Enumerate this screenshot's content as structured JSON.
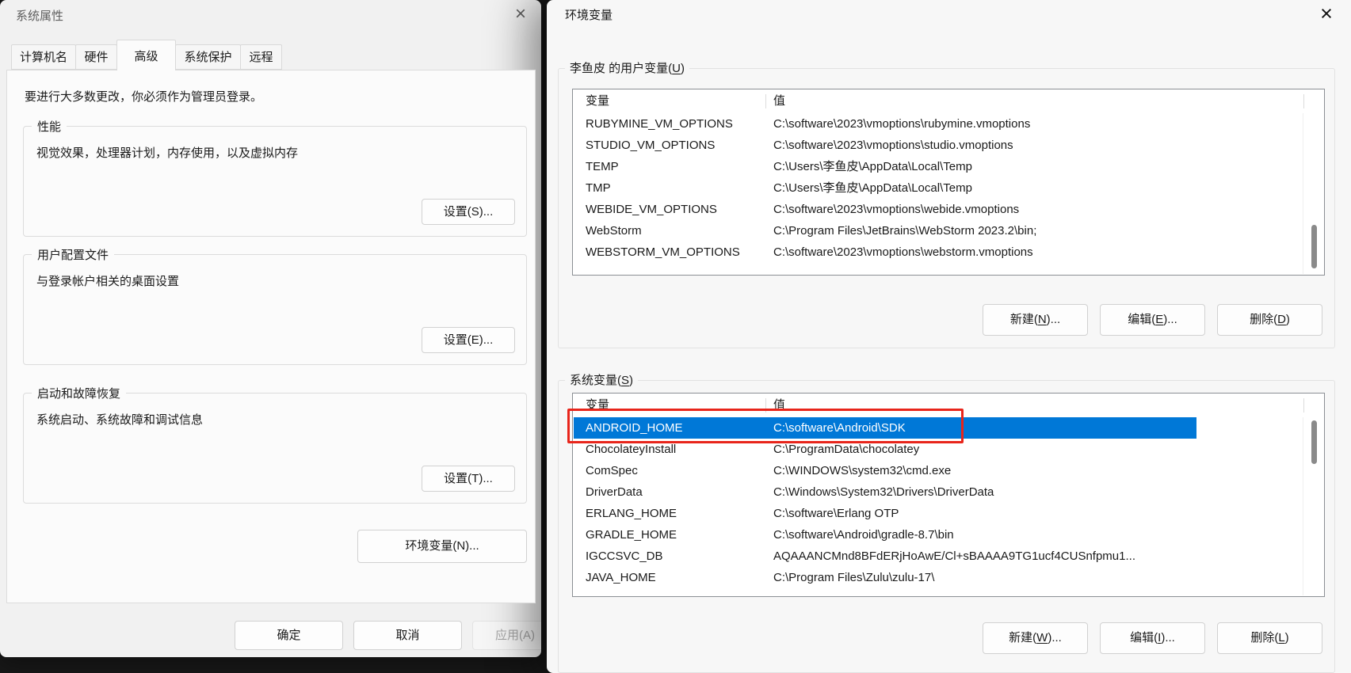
{
  "left_dialog": {
    "title": "系统属性",
    "close_icon": "×",
    "tabs": [
      {
        "label": "计算机名"
      },
      {
        "label": "硬件"
      },
      {
        "label": "高级"
      },
      {
        "label": "系统保护"
      },
      {
        "label": "远程"
      }
    ],
    "active_tab": "高级",
    "admin_note": "要进行大多数更改，你必须作为管理员登录。",
    "groups": [
      {
        "caption": "性能",
        "desc": "视觉效果，处理器计划，内存使用，以及虚拟内存",
        "button": "设置(S)..."
      },
      {
        "caption": "用户配置文件",
        "desc": "与登录帐户相关的桌面设置",
        "button": "设置(E)..."
      },
      {
        "caption": "启动和故障恢复",
        "desc": "系统启动、系统故障和调试信息",
        "button": "设置(T)..."
      }
    ],
    "env_vars_button": "环境变量(N)...",
    "footer": {
      "ok": "确定",
      "cancel": "取消",
      "apply": "应用(A)"
    }
  },
  "right_dialog": {
    "title": "环境变量",
    "close_icon": "×",
    "user_section": {
      "label_pre": "李鱼皮 的用户变量(",
      "label_mn": "U",
      "label_post": ")"
    },
    "user_table": {
      "col_variable": "变量",
      "col_value": "值",
      "rows": [
        {
          "name": "RUBYMINE_VM_OPTIONS",
          "value": "C:\\software\\2023\\vmoptions\\rubymine.vmoptions"
        },
        {
          "name": "STUDIO_VM_OPTIONS",
          "value": "C:\\software\\2023\\vmoptions\\studio.vmoptions"
        },
        {
          "name": "TEMP",
          "value": "C:\\Users\\李鱼皮\\AppData\\Local\\Temp"
        },
        {
          "name": "TMP",
          "value": "C:\\Users\\李鱼皮\\AppData\\Local\\Temp"
        },
        {
          "name": "WEBIDE_VM_OPTIONS",
          "value": "C:\\software\\2023\\vmoptions\\webide.vmoptions"
        },
        {
          "name": "WebStorm",
          "value": "C:\\Program Files\\JetBrains\\WebStorm 2023.2\\bin;"
        },
        {
          "name": "WEBSTORM_VM_OPTIONS",
          "value": "C:\\software\\2023\\vmoptions\\webstorm.vmoptions"
        }
      ]
    },
    "user_buttons": {
      "new": {
        "pre": "新建(",
        "mn": "N",
        "post": ")..."
      },
      "edit": {
        "pre": "编辑(",
        "mn": "E",
        "post": ")..."
      },
      "delete": {
        "pre": "删除(",
        "mn": "D",
        "post": ")"
      }
    },
    "system_section": {
      "label_pre": "系统变量(",
      "label_mn": "S",
      "label_post": ")"
    },
    "system_table": {
      "col_variable": "变量",
      "col_value": "值",
      "selected_row": "ANDROID_HOME",
      "rows": [
        {
          "name": "ANDROID_HOME",
          "value": "C:\\software\\Android\\SDK"
        },
        {
          "name": "ChocolateyInstall",
          "value": "C:\\ProgramData\\chocolatey"
        },
        {
          "name": "ComSpec",
          "value": "C:\\WINDOWS\\system32\\cmd.exe"
        },
        {
          "name": "DriverData",
          "value": "C:\\Windows\\System32\\Drivers\\DriverData"
        },
        {
          "name": "ERLANG_HOME",
          "value": "C:\\software\\Erlang OTP"
        },
        {
          "name": "GRADLE_HOME",
          "value": "C:\\software\\Android\\gradle-8.7\\bin"
        },
        {
          "name": "IGCCSVC_DB",
          "value": "AQAAANCMnd8BFdERjHoAwE/Cl+sBAAAA9TG1ucf4CUSnfpmu1..."
        },
        {
          "name": "JAVA_HOME",
          "value": "C:\\Program Files\\Zulu\\zulu-17\\"
        }
      ]
    },
    "system_buttons": {
      "new": {
        "pre": "新建(",
        "mn": "W",
        "post": ")..."
      },
      "edit": {
        "pre": "编辑(",
        "mn": "I",
        "post": ")"
      },
      "delete": {
        "pre": "删除(",
        "mn": "L",
        "post": ")"
      }
    },
    "colors": {
      "selection": "#0078d7",
      "annotation": "#e8251b"
    }
  }
}
